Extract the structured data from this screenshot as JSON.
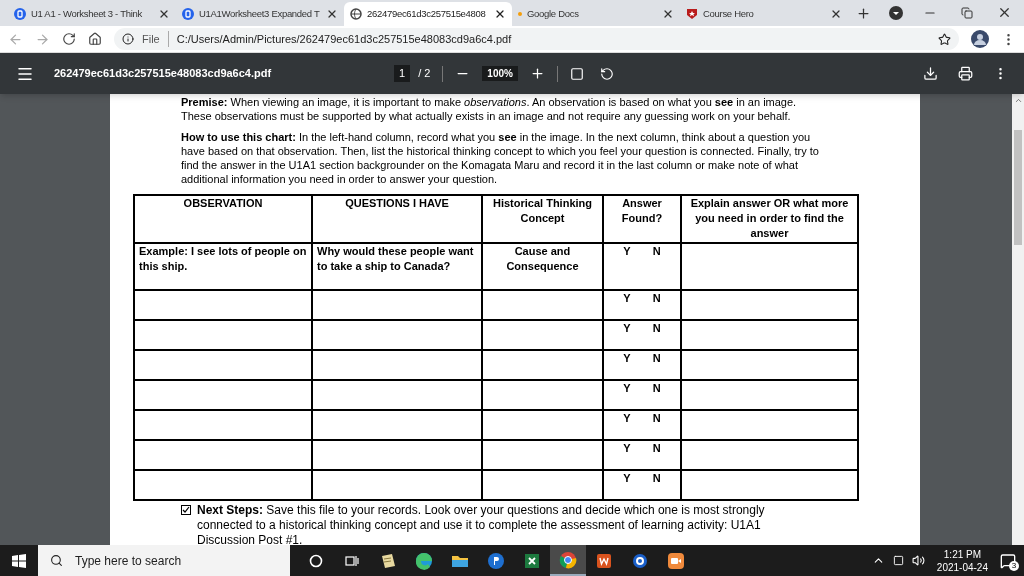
{
  "browser": {
    "tabs": [
      {
        "title": "U1 A1 - Worksheet 3 - Think",
        "kind": "b-logo",
        "selected": false
      },
      {
        "title": "U1A1Worksheet3 Expanded T",
        "kind": "b-logo",
        "selected": false
      },
      {
        "title": "262479ec61d3c257515e4808",
        "kind": "globe",
        "selected": true
      },
      {
        "title": "Google Docs",
        "kind": "docs",
        "selected": false
      },
      {
        "title": "Course Hero",
        "kind": "hero",
        "selected": false
      }
    ],
    "address": {
      "scheme": "File",
      "url": "C:/Users/Admin/Pictures/262479ec61d3c257515e48083cd9a6c4.pdf"
    }
  },
  "pdf_toolbar": {
    "filename": "262479ec61d3c257515e48083cd9a6c4.pdf",
    "page": "1",
    "total": "/ 2",
    "zoom": "100%"
  },
  "document": {
    "premise": "**Premise:** When viewing an image, it is important to make *observations*. An observation is based on what you **see** in an image.",
    "premise_2": "These observations must be supported by what actually exists in an image and not require any guessing work on your behalf.",
    "how_to": "**How to use this chart:** In the left-hand column, record what you **see** in the image. In the next column, think about a question you have based on that observation. Then, list the historical thinking concept to which you feel your question is connected. Finally, try to find the answer in the U1A1 section backgrounder on the Komagata Maru and record it in the last column or make note of what additional information you need in order to answer your question.",
    "table": {
      "columns": [
        "OBSERVATION",
        "QUESTIONS I HAVE",
        "Historical Thinking Concept",
        "Answer Found?",
        "Explain answer OR what more you need in order to find the answer"
      ],
      "rows": [
        {
          "observation": "Example: I see lots of people on this ship.",
          "question": "Why would these people want to take a ship to Canada?",
          "concept": "Cause and Consequence",
          "yes": "Y",
          "no": "N"
        },
        {
          "yes": "Y",
          "no": "N"
        },
        {
          "yes": "Y",
          "no": "N"
        },
        {
          "yes": "Y",
          "no": "N"
        },
        {
          "yes": "Y",
          "no": "N"
        },
        {
          "yes": "Y",
          "no": "N"
        },
        {
          "yes": "Y",
          "no": "N"
        },
        {
          "yes": "Y",
          "no": "N"
        }
      ]
    },
    "next_steps": {
      "checked": true,
      "text": "**Next Steps:** Save this file to your records. Look over your questions and decide which one is most strongly connected to a historical thinking concept and use it to complete the assessment of learning activity: U1A1 Discussion Post #1."
    }
  },
  "taskbar": {
    "search_placeholder": "Type here to search",
    "apps": [
      {
        "kind": "cortana",
        "selected": false
      },
      {
        "kind": "taskview",
        "selected": false
      },
      {
        "kind": "notes",
        "selected": false
      },
      {
        "kind": "edge",
        "selected": false
      },
      {
        "kind": "folder",
        "selected": false
      },
      {
        "kind": "publisher",
        "selected": false
      },
      {
        "kind": "excel",
        "selected": false
      },
      {
        "kind": "chrome",
        "selected": true
      },
      {
        "kind": "word",
        "selected": false
      },
      {
        "kind": "ie",
        "selected": false
      },
      {
        "kind": "camera",
        "selected": false
      }
    ],
    "time": "1:21 PM",
    "date": "2021-04-24",
    "notifications": "3"
  }
}
